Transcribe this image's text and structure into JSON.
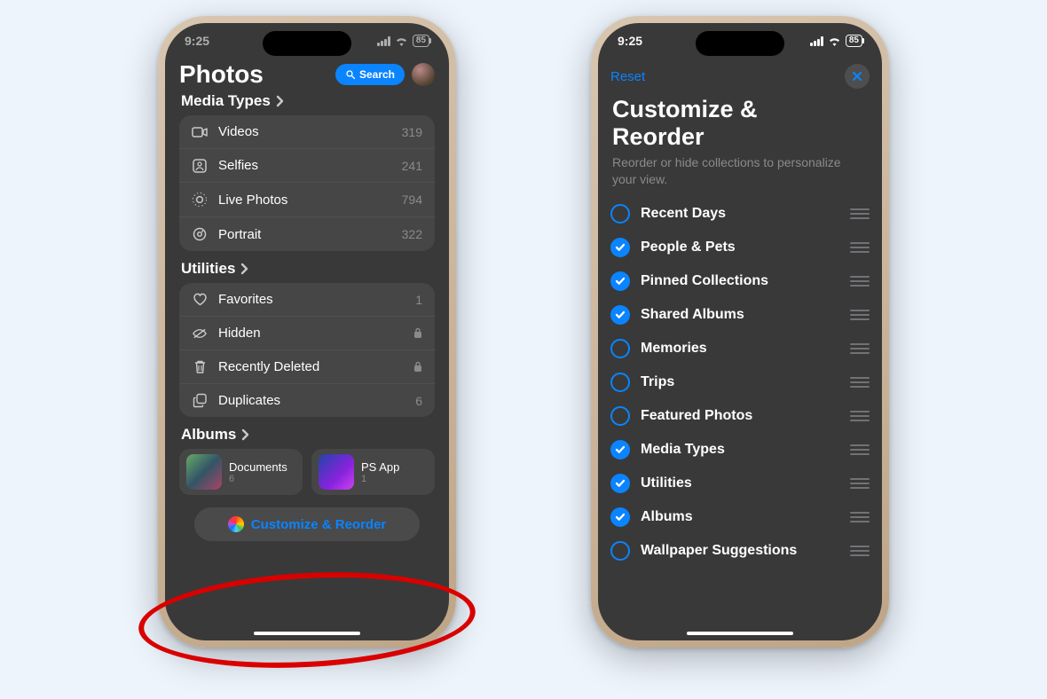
{
  "status": {
    "time": "9:25",
    "battery": "85"
  },
  "left": {
    "app_title": "Photos",
    "search_label": "Search",
    "sections": {
      "media_types": {
        "title": "Media Types",
        "items": [
          {
            "icon": "video-icon",
            "label": "Videos",
            "count": "319"
          },
          {
            "icon": "selfie-icon",
            "label": "Selfies",
            "count": "241"
          },
          {
            "icon": "livephoto-icon",
            "label": "Live Photos",
            "count": "794"
          },
          {
            "icon": "portrait-icon",
            "label": "Portrait",
            "count": "322"
          }
        ]
      },
      "utilities": {
        "title": "Utilities",
        "items": [
          {
            "icon": "heart-icon",
            "label": "Favorites",
            "count": "1"
          },
          {
            "icon": "hidden-icon",
            "label": "Hidden",
            "locked": true
          },
          {
            "icon": "trash-icon",
            "label": "Recently Deleted",
            "locked": true
          },
          {
            "icon": "duplicates-icon",
            "label": "Duplicates",
            "count": "6"
          }
        ]
      },
      "albums": {
        "title": "Albums",
        "items": [
          {
            "label": "Documents",
            "count": "6"
          },
          {
            "label": "PS App",
            "count": "1"
          }
        ]
      }
    },
    "customize_button": "Customize & Reorder"
  },
  "right": {
    "reset_label": "Reset",
    "title_line1": "Customize &",
    "title_line2": "Reorder",
    "subtitle": "Reorder or hide collections to personalize your view.",
    "options": [
      {
        "label": "Recent Days",
        "checked": false
      },
      {
        "label": "People & Pets",
        "checked": true
      },
      {
        "label": "Pinned Collections",
        "checked": true
      },
      {
        "label": "Shared Albums",
        "checked": true
      },
      {
        "label": "Memories",
        "checked": false
      },
      {
        "label": "Trips",
        "checked": false
      },
      {
        "label": "Featured Photos",
        "checked": false
      },
      {
        "label": "Media Types",
        "checked": true
      },
      {
        "label": "Utilities",
        "checked": true
      },
      {
        "label": "Albums",
        "checked": true
      },
      {
        "label": "Wallpaper Suggestions",
        "checked": false
      }
    ]
  }
}
